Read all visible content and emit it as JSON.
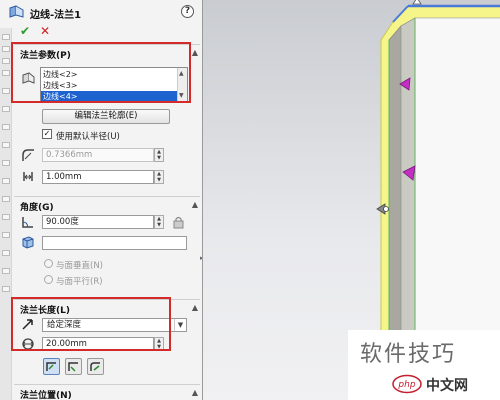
{
  "panel": {
    "title": "边线-法兰1",
    "help": "?",
    "ok": "✔",
    "cancel": "✕"
  },
  "flange_params": {
    "header": "法兰参数(P)",
    "edges": [
      "边线<2>",
      "边线<3>",
      "边线<4>"
    ],
    "selected_edge_index": 2,
    "edit_profile_button": "编辑法兰轮廓(E)",
    "use_default_radius_label": "使用默认半径(U)",
    "use_default_radius_checked": true,
    "radius_value": "0.7366mm",
    "gap_value": "1.00mm"
  },
  "angle": {
    "header": "角度(G)",
    "angle_value": "90.00度",
    "face_value": "",
    "perpendicular_label": "与面垂直(N)",
    "parallel_label": "与面平行(R)"
  },
  "flange_length": {
    "header": "法兰长度(L)",
    "end_condition": "给定深度",
    "length_value": "20.00mm"
  },
  "flange_position": {
    "header": "法兰位置(N)"
  },
  "watermark": {
    "text": "软件技巧",
    "site": "中文网",
    "logo": "php"
  },
  "colors": {
    "highlight_red": "#d42a2a",
    "selection_blue": "#1e62d0",
    "preview_yellow": "#f5f58a",
    "handle_magenta": "#c22fc2"
  }
}
